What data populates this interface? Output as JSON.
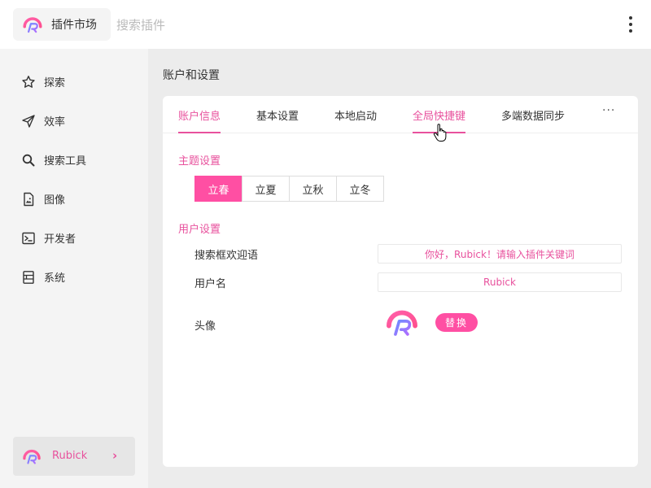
{
  "header": {
    "brand_label": "插件市场",
    "search_placeholder": "搜索插件",
    "more_icon": "more-vertical-icon"
  },
  "sidebar": {
    "items": [
      {
        "label": "探索",
        "icon": "star-icon"
      },
      {
        "label": "效率",
        "icon": "send-icon"
      },
      {
        "label": "搜索工具",
        "icon": "search-icon"
      },
      {
        "label": "图像",
        "icon": "image-file-icon"
      },
      {
        "label": "开发者",
        "icon": "terminal-icon"
      },
      {
        "label": "系统",
        "icon": "system-icon"
      }
    ],
    "user": {
      "name": "Rubick",
      "chevron": "›"
    }
  },
  "page": {
    "title": "账户和设置"
  },
  "tabs": {
    "items": [
      "账户信息",
      "基本设置",
      "本地启动",
      "全局快捷键",
      "多端数据同步"
    ],
    "active_index": 0,
    "hovered_index": 3,
    "more": "···"
  },
  "theme": {
    "title": "主题设置",
    "options": [
      "立春",
      "立夏",
      "立秋",
      "立冬"
    ],
    "selected": "立春"
  },
  "user_settings": {
    "title": "用户设置",
    "welcome_label": "搜索框欢迎语",
    "welcome_value": "你好，Rubick！请输入插件关键词",
    "username_label": "用户名",
    "username_value": "Rubick",
    "avatar_label": "头像",
    "replace_label": "替换"
  },
  "colors": {
    "accent": "#ff4fa3",
    "accent_text": "#e8519d",
    "sidebar_bg": "#f4f4f4",
    "page_bg": "#ececec"
  }
}
